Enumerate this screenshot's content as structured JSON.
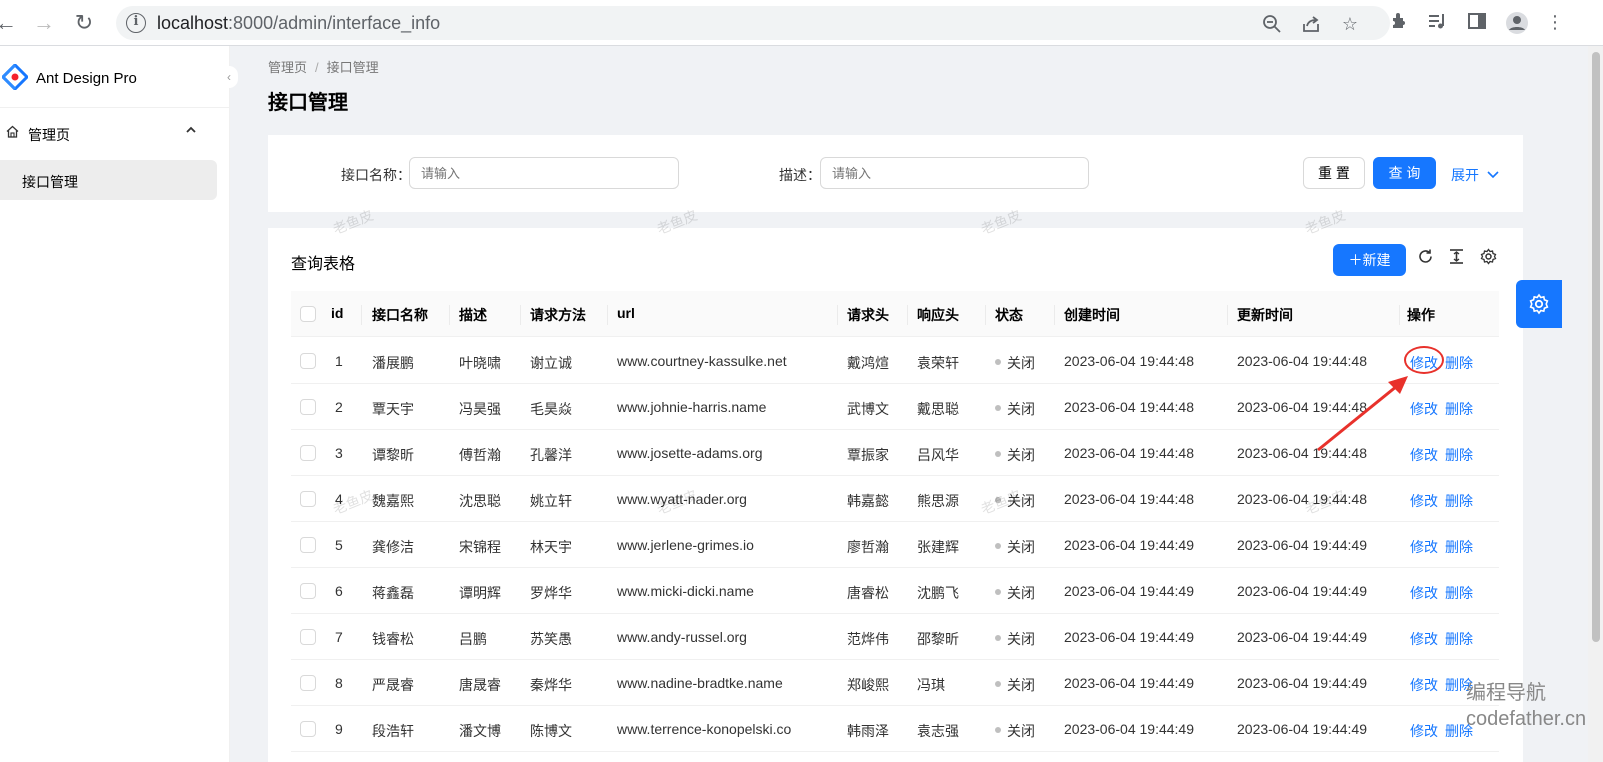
{
  "browser": {
    "url_host": "localhost",
    "url_rest": ":8000/admin/interface_info",
    "icons": [
      "back-icon",
      "forward-icon",
      "reload-icon",
      "info-icon",
      "zoom-out-icon",
      "share-icon",
      "bookmark-star-icon",
      "extensions-icon",
      "media-icon",
      "side-panel-icon",
      "profile-icon",
      "more-icon"
    ]
  },
  "sidebar": {
    "app_title": "Ant Design Pro",
    "menu_parent": "管理页",
    "menu_child": "接口管理"
  },
  "header": {
    "breadcrumb": [
      "管理页",
      "接口管理"
    ],
    "breadcrumb_sep": "/",
    "title": "接口管理"
  },
  "search": {
    "name_label": "接口名称",
    "name_placeholder": "请输入",
    "desc_label": "描述",
    "desc_placeholder": "请输入",
    "reset_label": "重 置",
    "query_label": "查 询",
    "expand_label": "展开"
  },
  "table": {
    "title": "查询表格",
    "new_label": "新建",
    "columns": [
      "id",
      "接口名称",
      "描述",
      "请求方法",
      "url",
      "请求头",
      "响应头",
      "状态",
      "创建时间",
      "更新时间",
      "操作"
    ],
    "edit_label": "修改",
    "delete_label": "删除",
    "rows": [
      {
        "id": "1",
        "name": "潘展鹏",
        "desc": "叶晓啸",
        "method": "谢立诚",
        "url": "www.courtney-kassulke.net",
        "req": "戴鸿煊",
        "res": "袁荣轩",
        "status": "关闭",
        "created": "2023-06-04 19:44:48",
        "updated": "2023-06-04 19:44:48"
      },
      {
        "id": "2",
        "name": "覃天宇",
        "desc": "冯昊强",
        "method": "毛昊焱",
        "url": "www.johnie-harris.name",
        "req": "武博文",
        "res": "戴思聪",
        "status": "关闭",
        "created": "2023-06-04 19:44:48",
        "updated": "2023-06-04 19:44:48"
      },
      {
        "id": "3",
        "name": "谭黎昕",
        "desc": "傅哲瀚",
        "method": "孔馨洋",
        "url": "www.josette-adams.org",
        "req": "覃振家",
        "res": "吕风华",
        "status": "关闭",
        "created": "2023-06-04 19:44:48",
        "updated": "2023-06-04 19:44:48"
      },
      {
        "id": "4",
        "name": "魏嘉熙",
        "desc": "沈思聪",
        "method": "姚立轩",
        "url": "www.wyatt-nader.org",
        "req": "韩嘉懿",
        "res": "熊思源",
        "status": "关闭",
        "created": "2023-06-04 19:44:48",
        "updated": "2023-06-04 19:44:48"
      },
      {
        "id": "5",
        "name": "龚修洁",
        "desc": "宋锦程",
        "method": "林天宇",
        "url": "www.jerlene-grimes.io",
        "req": "廖哲瀚",
        "res": "张建辉",
        "status": "关闭",
        "created": "2023-06-04 19:44:49",
        "updated": "2023-06-04 19:44:49"
      },
      {
        "id": "6",
        "name": "蒋鑫磊",
        "desc": "谭明辉",
        "method": "罗烨华",
        "url": "www.micki-dicki.name",
        "req": "唐睿松",
        "res": "沈鹏飞",
        "status": "关闭",
        "created": "2023-06-04 19:44:49",
        "updated": "2023-06-04 19:44:49"
      },
      {
        "id": "7",
        "name": "钱睿松",
        "desc": "吕鹏",
        "method": "苏笑愚",
        "url": "www.andy-russel.org",
        "req": "范烨伟",
        "res": "邵黎昕",
        "status": "关闭",
        "created": "2023-06-04 19:44:49",
        "updated": "2023-06-04 19:44:49"
      },
      {
        "id": "8",
        "name": "严晟睿",
        "desc": "唐晟睿",
        "method": "秦烨华",
        "url": "www.nadine-bradtke.name",
        "req": "郑峻熙",
        "res": "冯琪",
        "status": "关闭",
        "created": "2023-06-04 19:44:49",
        "updated": "2023-06-04 19:44:49"
      },
      {
        "id": "9",
        "name": "段浩轩",
        "desc": "潘文博",
        "method": "陈博文",
        "url": "www.terrence-konopelski.co",
        "req": "韩雨泽",
        "res": "袁志强",
        "status": "关闭",
        "created": "2023-06-04 19:44:49",
        "updated": "2023-06-04 19:44:49"
      }
    ]
  },
  "watermark": "老鱼皮",
  "corner_watermark": [
    "编程导航",
    "codefather.cn"
  ],
  "colors": {
    "primary": "#1677ff",
    "annotation": "#e8312b"
  }
}
